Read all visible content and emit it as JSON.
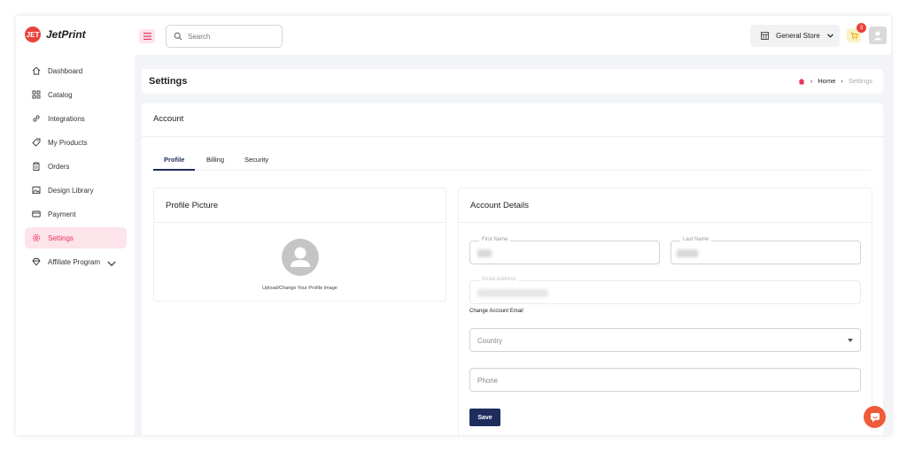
{
  "app": {
    "name": "JetPrint",
    "logo_mark": "JET"
  },
  "topbar": {
    "search_placeholder": "Search",
    "store_selector": "General Store",
    "cart_count": "3"
  },
  "sidebar": {
    "items": [
      {
        "label": "Dashboard",
        "icon": "home-icon"
      },
      {
        "label": "Catalog",
        "icon": "grid-icon"
      },
      {
        "label": "Integrations",
        "icon": "link-icon"
      },
      {
        "label": "My Products",
        "icon": "tag-icon"
      },
      {
        "label": "Orders",
        "icon": "clipboard-icon"
      },
      {
        "label": "Design Library",
        "icon": "image-icon"
      },
      {
        "label": "Payment",
        "icon": "card-icon"
      },
      {
        "label": "Settings",
        "icon": "gear-icon",
        "active": true
      },
      {
        "label": "Affiliate Program",
        "icon": "diamond-icon"
      }
    ]
  },
  "page": {
    "title": "Settings",
    "breadcrumb": {
      "home": "Home",
      "current": "Settings"
    }
  },
  "account": {
    "title": "Account",
    "tabs": [
      "Profile",
      "Billing",
      "Security"
    ],
    "active_tab": "Profile"
  },
  "profile_picture": {
    "title": "Profile Picture",
    "caption": "Upload/Change Your Profile Image"
  },
  "account_details": {
    "title": "Account Details",
    "first_name_label": "First Name",
    "last_name_label": "Last Name",
    "email_label": "Email Address",
    "change_email": "Change Account Email",
    "country_placeholder": "Country",
    "phone_placeholder": "Phone",
    "save_label": "Save"
  },
  "colors": {
    "accent": "#e8335f",
    "primary": "#1f2d5c",
    "background": "#f3f4f8"
  }
}
